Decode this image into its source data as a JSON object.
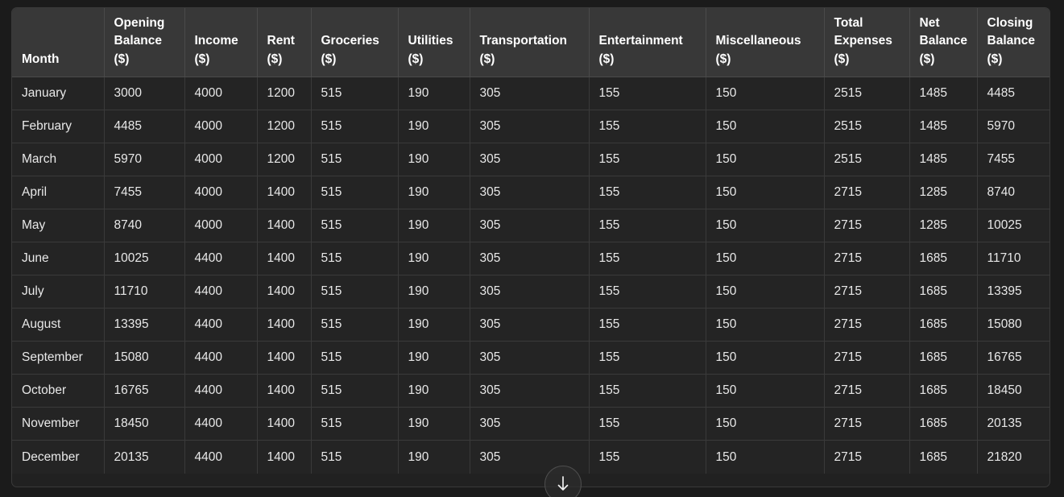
{
  "table": {
    "headers": [
      "Month",
      "Opening Balance ($)",
      "Income ($)",
      "Rent ($)",
      "Groceries ($)",
      "Utilities ($)",
      "Transportation ($)",
      "Entertainment ($)",
      "Miscellaneous ($)",
      "Total Expenses ($)",
      "Net Balance ($)",
      "Closing Balance ($)"
    ],
    "rows": [
      [
        "January",
        "3000",
        "4000",
        "1200",
        "515",
        "190",
        "305",
        "155",
        "150",
        "2515",
        "1485",
        "4485"
      ],
      [
        "February",
        "4485",
        "4000",
        "1200",
        "515",
        "190",
        "305",
        "155",
        "150",
        "2515",
        "1485",
        "5970"
      ],
      [
        "March",
        "5970",
        "4000",
        "1200",
        "515",
        "190",
        "305",
        "155",
        "150",
        "2515",
        "1485",
        "7455"
      ],
      [
        "April",
        "7455",
        "4000",
        "1400",
        "515",
        "190",
        "305",
        "155",
        "150",
        "2715",
        "1285",
        "8740"
      ],
      [
        "May",
        "8740",
        "4000",
        "1400",
        "515",
        "190",
        "305",
        "155",
        "150",
        "2715",
        "1285",
        "10025"
      ],
      [
        "June",
        "10025",
        "4400",
        "1400",
        "515",
        "190",
        "305",
        "155",
        "150",
        "2715",
        "1685",
        "11710"
      ],
      [
        "July",
        "11710",
        "4400",
        "1400",
        "515",
        "190",
        "305",
        "155",
        "150",
        "2715",
        "1685",
        "13395"
      ],
      [
        "August",
        "13395",
        "4400",
        "1400",
        "515",
        "190",
        "305",
        "155",
        "150",
        "2715",
        "1685",
        "15080"
      ],
      [
        "September",
        "15080",
        "4400",
        "1400",
        "515",
        "190",
        "305",
        "155",
        "150",
        "2715",
        "1685",
        "16765"
      ],
      [
        "October",
        "16765",
        "4400",
        "1400",
        "515",
        "190",
        "305",
        "155",
        "150",
        "2715",
        "1685",
        "18450"
      ],
      [
        "November",
        "18450",
        "4400",
        "1400",
        "515",
        "190",
        "305",
        "155",
        "150",
        "2715",
        "1685",
        "20135"
      ],
      [
        "December",
        "20135",
        "4400",
        "1400",
        "515",
        "190",
        "305",
        "155",
        "150",
        "2715",
        "1685",
        "21820"
      ]
    ]
  },
  "controls": {
    "scroll_down_icon": "arrow-down-icon"
  },
  "colors": {
    "page_background": "#1b1b1b",
    "header_background": "#383838",
    "cell_background": "#242424",
    "header_text": "#ffffff",
    "cell_text": "#e8e8e8",
    "border": "#3a3a3a"
  }
}
